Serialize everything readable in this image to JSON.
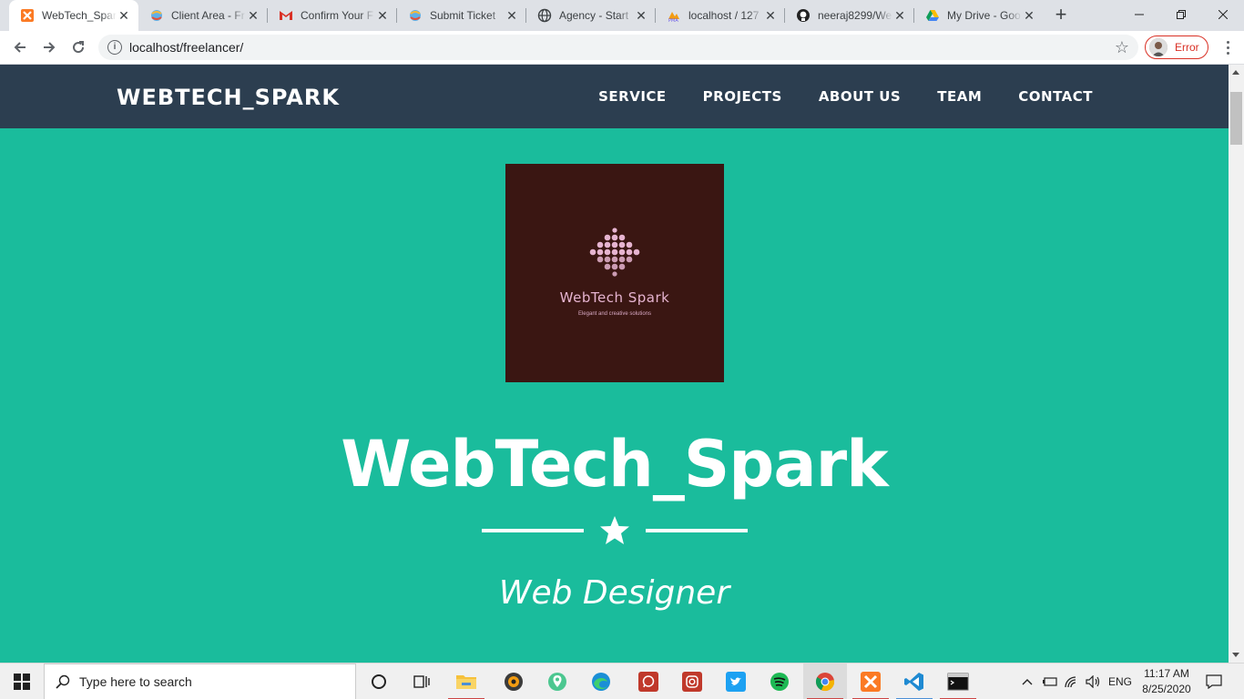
{
  "browser": {
    "tabs": [
      {
        "title": "WebTech_Spark",
        "icon": "xampp-icon",
        "active": true
      },
      {
        "title": "Client Area - Fr",
        "icon": "colorful-globe-icon"
      },
      {
        "title": "Confirm Your F",
        "icon": "gmail-icon"
      },
      {
        "title": "Submit Ticket",
        "icon": "colorful-globe-icon"
      },
      {
        "title": "Agency - Start",
        "icon": "globe-icon"
      },
      {
        "title": "localhost / 127",
        "icon": "phpmyadmin-icon"
      },
      {
        "title": "neeraj8299/We",
        "icon": "github-icon"
      },
      {
        "title": "My Drive - Goo",
        "icon": "google-drive-icon"
      }
    ],
    "url": "localhost/freelancer/",
    "profile_status": "Error"
  },
  "site": {
    "brand": "WEBTECH_SPARK",
    "nav": [
      "SERVICE",
      "PROJECTS",
      "ABOUT US",
      "TEAM",
      "CONTACT"
    ],
    "logo": {
      "name": "WebTech Spark",
      "tagline": "Elegant and creative solutions",
      "background": "#3a1612",
      "dot_color": "#e6b4d0"
    },
    "title": "WebTech_Spark",
    "subtitle": "Web Designer",
    "colors": {
      "primary": "#1abc9c",
      "navbar": "#2c3e50"
    }
  },
  "taskbar": {
    "search_placeholder": "Type here to search",
    "language": "ENG",
    "time": "11:17 AM",
    "date": "8/25/2020"
  }
}
